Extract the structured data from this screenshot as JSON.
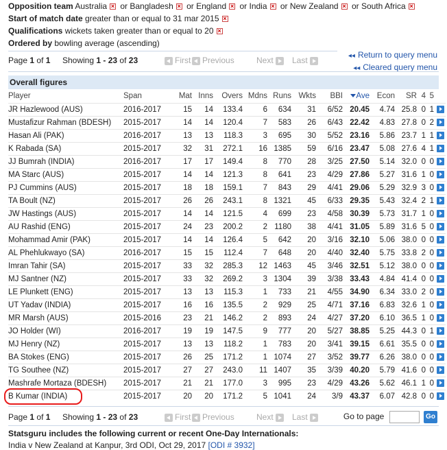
{
  "filters": {
    "opposition_label": "Opposition team",
    "opposition_values": [
      "Australia",
      "or Bangladesh",
      "or England",
      "or India",
      "or New Zealand",
      "or South Africa"
    ],
    "date_label": "Start of match date",
    "date_value": "greater than or equal to 31 mar 2015",
    "qual_label": "Qualifications",
    "qual_value": "wickets taken greater than or equal to 20",
    "order_label": "Ordered by",
    "order_value": "bowling average (ascending)"
  },
  "pager": {
    "page_text": "Page",
    "page_num": "1",
    "of_text": "of",
    "page_total": "1",
    "showing_text": "Showing",
    "range": "1 - 23",
    "of2": "of",
    "total": "23",
    "first": "First",
    "previous": "Previous",
    "next": "Next",
    "last": "Last"
  },
  "links": {
    "return": "Return to query menu",
    "cleared": "Cleared query menu"
  },
  "table": {
    "caption": "Overall figures",
    "headers": [
      "Player",
      "Span",
      "Mat",
      "Inns",
      "Overs",
      "Mdns",
      "Runs",
      "Wkts",
      "BBI",
      "Ave",
      "Econ",
      "SR",
      "4",
      "5"
    ],
    "rows": [
      [
        "JR Hazlewood (AUS)",
        "2016-2017",
        "15",
        "14",
        "133.4",
        "6",
        "634",
        "31",
        "6/52",
        "20.45",
        "4.74",
        "25.8",
        "0",
        "1"
      ],
      [
        "Mustafizur Rahman (BDESH)",
        "2015-2017",
        "14",
        "14",
        "120.4",
        "7",
        "583",
        "26",
        "6/43",
        "22.42",
        "4.83",
        "27.8",
        "0",
        "2"
      ],
      [
        "Hasan Ali (PAK)",
        "2016-2017",
        "13",
        "13",
        "118.3",
        "3",
        "695",
        "30",
        "5/52",
        "23.16",
        "5.86",
        "23.7",
        "1",
        "1"
      ],
      [
        "K Rabada (SA)",
        "2015-2017",
        "32",
        "31",
        "272.1",
        "16",
        "1385",
        "59",
        "6/16",
        "23.47",
        "5.08",
        "27.6",
        "4",
        "1"
      ],
      [
        "JJ Bumrah (INDIA)",
        "2016-2017",
        "17",
        "17",
        "149.4",
        "8",
        "770",
        "28",
        "3/25",
        "27.50",
        "5.14",
        "32.0",
        "0",
        "0"
      ],
      [
        "MA Starc (AUS)",
        "2015-2017",
        "14",
        "14",
        "121.3",
        "8",
        "641",
        "23",
        "4/29",
        "27.86",
        "5.27",
        "31.6",
        "1",
        "0"
      ],
      [
        "PJ Cummins (AUS)",
        "2015-2017",
        "18",
        "18",
        "159.1",
        "7",
        "843",
        "29",
        "4/41",
        "29.06",
        "5.29",
        "32.9",
        "3",
        "0"
      ],
      [
        "TA Boult (NZ)",
        "2015-2017",
        "26",
        "26",
        "243.1",
        "8",
        "1321",
        "45",
        "6/33",
        "29.35",
        "5.43",
        "32.4",
        "2",
        "1"
      ],
      [
        "JW Hastings (AUS)",
        "2015-2017",
        "14",
        "14",
        "121.5",
        "4",
        "699",
        "23",
        "4/58",
        "30.39",
        "5.73",
        "31.7",
        "1",
        "0"
      ],
      [
        "AU Rashid (ENG)",
        "2015-2017",
        "24",
        "23",
        "200.2",
        "2",
        "1180",
        "38",
        "4/41",
        "31.05",
        "5.89",
        "31.6",
        "5",
        "0"
      ],
      [
        "Mohammad Amir (PAK)",
        "2015-2017",
        "14",
        "14",
        "126.4",
        "5",
        "642",
        "20",
        "3/16",
        "32.10",
        "5.06",
        "38.0",
        "0",
        "0"
      ],
      [
        "AL Phehlukwayo (SA)",
        "2016-2017",
        "15",
        "15",
        "112.4",
        "7",
        "648",
        "20",
        "4/40",
        "32.40",
        "5.75",
        "33.8",
        "2",
        "0"
      ],
      [
        "Imran Tahir (SA)",
        "2015-2017",
        "33",
        "32",
        "285.3",
        "12",
        "1463",
        "45",
        "3/46",
        "32.51",
        "5.12",
        "38.0",
        "0",
        "0"
      ],
      [
        "MJ Santner (NZ)",
        "2015-2017",
        "33",
        "32",
        "269.2",
        "3",
        "1304",
        "39",
        "3/38",
        "33.43",
        "4.84",
        "41.4",
        "0",
        "0"
      ],
      [
        "LE Plunkett (ENG)",
        "2015-2017",
        "13",
        "13",
        "115.3",
        "1",
        "733",
        "21",
        "4/55",
        "34.90",
        "6.34",
        "33.0",
        "2",
        "0"
      ],
      [
        "UT Yadav (INDIA)",
        "2015-2017",
        "16",
        "16",
        "135.5",
        "2",
        "929",
        "25",
        "4/71",
        "37.16",
        "6.83",
        "32.6",
        "1",
        "0"
      ],
      [
        "MR Marsh (AUS)",
        "2015-2016",
        "23",
        "21",
        "146.2",
        "2",
        "893",
        "24",
        "4/27",
        "37.20",
        "6.10",
        "36.5",
        "1",
        "0"
      ],
      [
        "JO Holder (WI)",
        "2016-2017",
        "19",
        "19",
        "147.5",
        "9",
        "777",
        "20",
        "5/27",
        "38.85",
        "5.25",
        "44.3",
        "0",
        "1"
      ],
      [
        "MJ Henry (NZ)",
        "2015-2017",
        "13",
        "13",
        "118.2",
        "1",
        "783",
        "20",
        "3/41",
        "39.15",
        "6.61",
        "35.5",
        "0",
        "0"
      ],
      [
        "BA Stokes (ENG)",
        "2015-2017",
        "26",
        "25",
        "171.2",
        "1",
        "1074",
        "27",
        "3/52",
        "39.77",
        "6.26",
        "38.0",
        "0",
        "0"
      ],
      [
        "TG Southee (NZ)",
        "2015-2017",
        "27",
        "27",
        "243.0",
        "11",
        "1407",
        "35",
        "3/39",
        "40.20",
        "5.79",
        "41.6",
        "0",
        "0"
      ],
      [
        "Mashrafe Mortaza (BDESH)",
        "2015-2017",
        "21",
        "21",
        "177.0",
        "3",
        "995",
        "23",
        "4/29",
        "43.26",
        "5.62",
        "46.1",
        "1",
        "0"
      ],
      [
        "B Kumar (INDIA)",
        "2015-2017",
        "20",
        "20",
        "171.2",
        "5",
        "1041",
        "24",
        "3/9",
        "43.37",
        "6.07",
        "42.8",
        "0",
        "0"
      ]
    ]
  },
  "goto": {
    "label": "Go to page",
    "button": "Go"
  },
  "footer": {
    "title": "Statsguru includes the following current or recent One-Day Internationals:",
    "match": "India v New Zealand at Kanpur, 3rd ODI, Oct 29, 2017",
    "link": "[ODI # 3932]"
  },
  "colors": {
    "link": "#2255aa",
    "caption_bg": "#dde9f5",
    "highlight": "#e81b1b",
    "play_button": "#2f7fd0"
  }
}
